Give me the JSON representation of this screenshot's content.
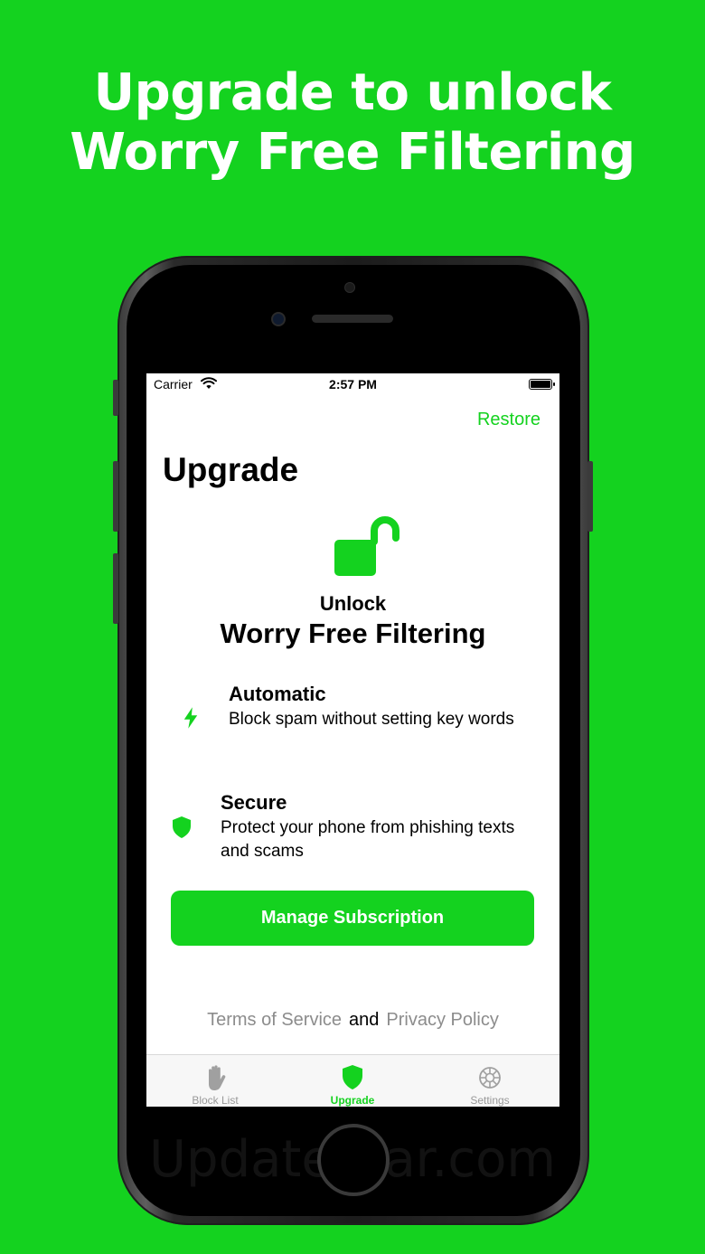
{
  "headline": {
    "line1": "Upgrade to unlock",
    "line2": "Worry Free Filtering"
  },
  "status_bar": {
    "carrier": "Carrier",
    "time": "2:57 PM"
  },
  "header": {
    "restore_label": "Restore",
    "title": "Upgrade"
  },
  "hero": {
    "unlock_label": "Unlock",
    "subtitle": "Worry Free Filtering"
  },
  "features": [
    {
      "title": "Automatic",
      "description": "Block spam without setting key words",
      "icon": "lightning-bolt-icon"
    },
    {
      "title": "Secure",
      "description": "Protect your phone from phishing texts and scams",
      "icon": "shield-icon"
    }
  ],
  "manage_button_label": "Manage Subscription",
  "legal": {
    "terms": "Terms of Service",
    "and": "and",
    "privacy": "Privacy Policy"
  },
  "tabs": [
    {
      "label": "Block List",
      "icon": "hand-icon",
      "active": false
    },
    {
      "label": "Upgrade",
      "icon": "shield-icon",
      "active": true
    },
    {
      "label": "Settings",
      "icon": "gear-icon",
      "active": false
    }
  ],
  "watermark": "UpdateStar.com",
  "colors": {
    "accent": "#14d21f",
    "background": "#14d21f",
    "link_gray": "#8c8c8c"
  }
}
